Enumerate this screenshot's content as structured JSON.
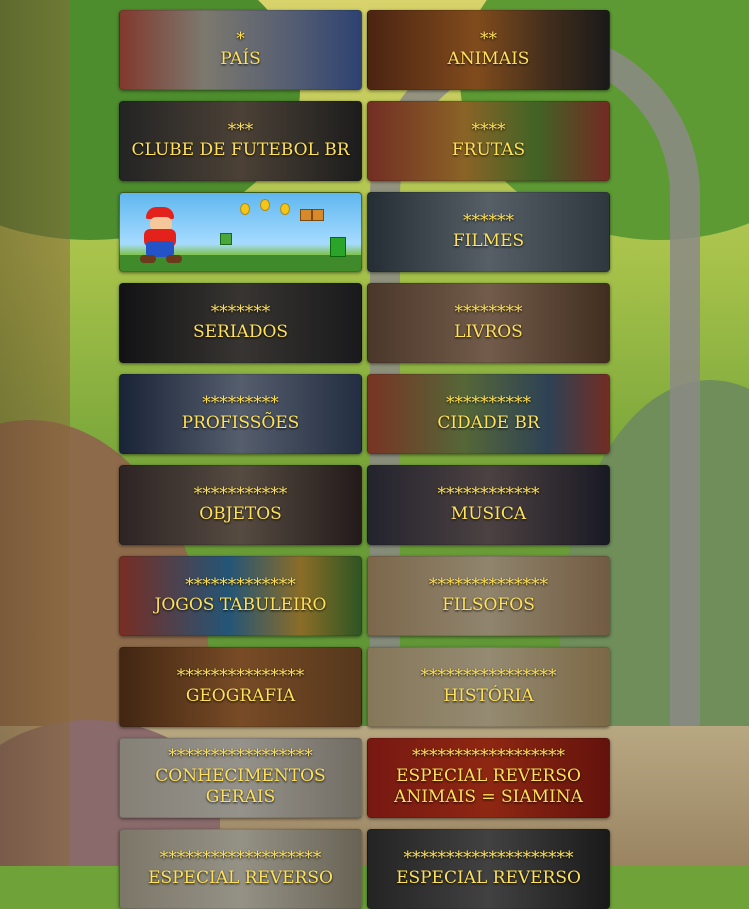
{
  "tiles": [
    {
      "stars": "*",
      "label": "PAÍS",
      "bg": "bg-pais"
    },
    {
      "stars": "**",
      "label": "ANIMAIS",
      "bg": "bg-animais"
    },
    {
      "stars": "***",
      "label": "CLUBE DE FUTEBOL BR",
      "bg": "bg-clube"
    },
    {
      "stars": "****",
      "label": "FRUTAS",
      "bg": "bg-frutas"
    },
    {
      "stars": "",
      "label": "",
      "bg": "bg-mario",
      "image": "mario-game-image"
    },
    {
      "stars": "******",
      "label": "FILMES",
      "bg": "bg-filmes"
    },
    {
      "stars": "*******",
      "label": "SERIADOS",
      "bg": "bg-seriados"
    },
    {
      "stars": "********",
      "label": "LIVROS",
      "bg": "bg-livros"
    },
    {
      "stars": "*********",
      "label": "PROFISSÕES",
      "bg": "bg-prof"
    },
    {
      "stars": "**********",
      "label": "CIDADE BR",
      "bg": "bg-cidade"
    },
    {
      "stars": "***********",
      "label": "OBJETOS",
      "bg": "bg-objetos"
    },
    {
      "stars": "************",
      "label": "MUSICA",
      "bg": "bg-musica"
    },
    {
      "stars": "*************",
      "label": "JOGOS TABULEIRO",
      "bg": "bg-jogos"
    },
    {
      "stars": "**************",
      "label": "FILSOFOS",
      "bg": "bg-filsofos"
    },
    {
      "stars": "***************",
      "label": "GEOGRAFIA",
      "bg": "bg-geo"
    },
    {
      "stars": "****************",
      "label": "HISTÓRIA",
      "bg": "bg-hist"
    },
    {
      "stars": "*****************",
      "label": "CONHECIMENTOS GERAIS",
      "bg": "bg-conhec"
    },
    {
      "stars": "******************",
      "label": "ESPECIAL REVERSO\nANIMAIS = SIAMINA",
      "bg": "bg-rev1"
    },
    {
      "stars": "*******************",
      "label": "ESPECIAL REVERSO",
      "bg": "bg-rev2"
    },
    {
      "stars": "********************",
      "label": "ESPECIAL REVERSO",
      "bg": "bg-rev3"
    }
  ]
}
